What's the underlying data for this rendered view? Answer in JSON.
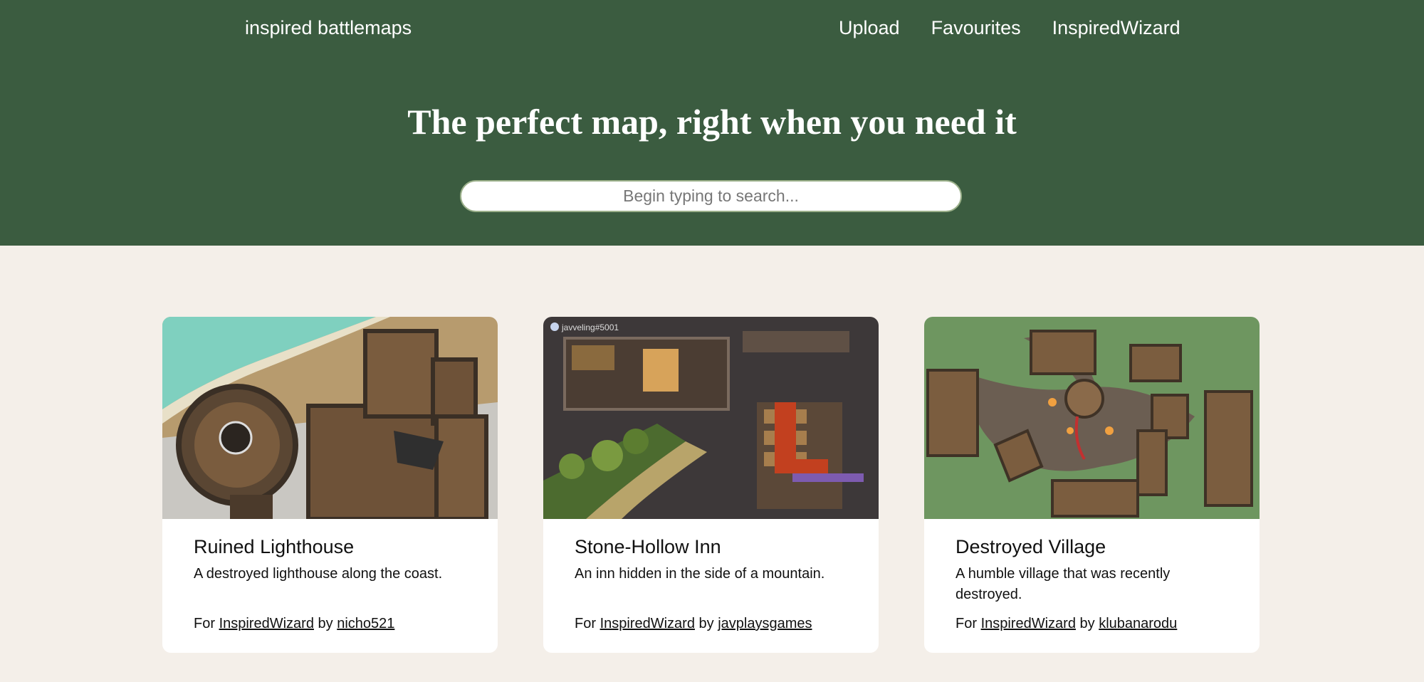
{
  "nav": {
    "brand": "inspired battlemaps",
    "links": [
      "Upload",
      "Favourites",
      "InspiredWizard"
    ]
  },
  "hero": {
    "headline": "The perfect map, right when you need it",
    "search_placeholder": "Begin typing to search..."
  },
  "cards": [
    {
      "title": "Ruined Lighthouse",
      "description": "A destroyed lighthouse along the coast.",
      "for_label": "For",
      "for_name": "InspiredWizard",
      "by_label": "by",
      "author": "nicho521",
      "watermark": ""
    },
    {
      "title": "Stone-Hollow Inn",
      "description": "An inn hidden in the side of a mountain.",
      "for_label": "For",
      "for_name": "InspiredWizard",
      "by_label": "by",
      "author": "javplaysgames",
      "watermark": "javveling#5001"
    },
    {
      "title": "Destroyed Village",
      "description": "A humble village that was recently destroyed.",
      "for_label": "For",
      "for_name": "InspiredWizard",
      "by_label": "by",
      "author": "klubanarodu",
      "watermark": ""
    }
  ],
  "colors": {
    "header_bg": "#3b5c40",
    "page_bg": "#f4efe9",
    "card_bg": "#ffffff"
  }
}
